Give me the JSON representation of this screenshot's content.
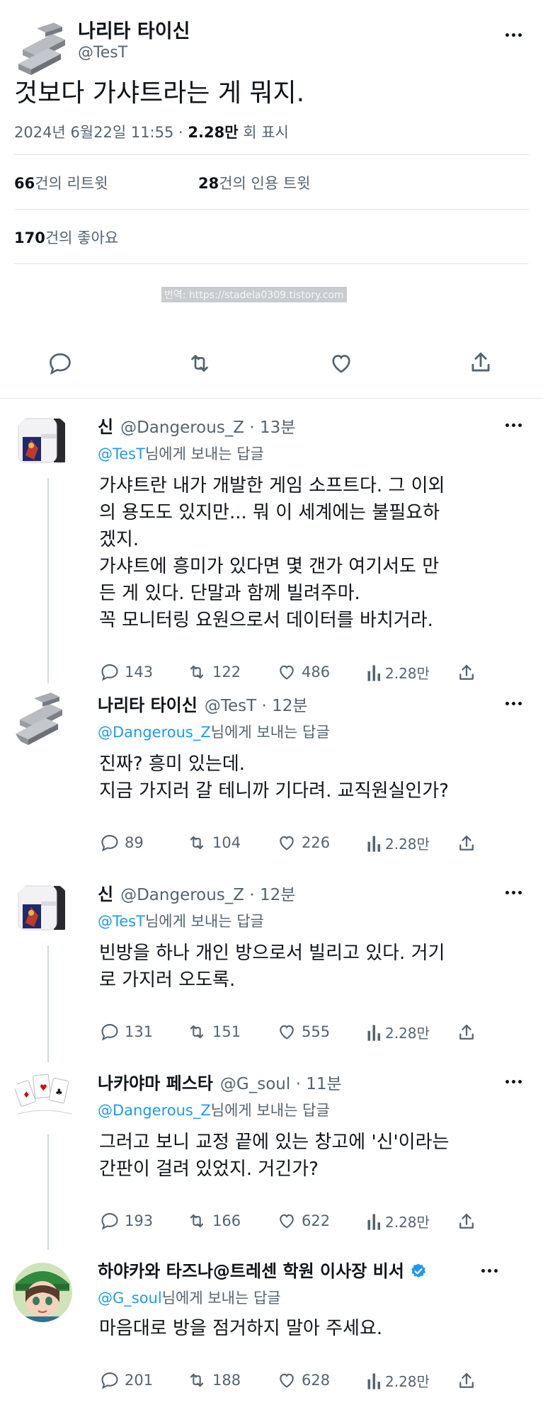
{
  "main_tweet": {
    "display_name": "나리타 타이신",
    "handle": "@TesT",
    "text": "것보다 가샤트라는 게 뭐지.",
    "timestamp": "2024년 6월22일 11:55 · ",
    "views_count": "2.28만",
    "views_label": " 회 표시",
    "retweets_count": "66",
    "retweets_label": "건의 리트윗",
    "quotes_count": "28",
    "quotes_label": "건의 인용 트윗",
    "likes_count": "170",
    "likes_label": "건의 좋아요",
    "watermark": "번역: https://stadela0309.tistory.com"
  },
  "replies": [
    {
      "display_name": "신",
      "handle": "@Dangerous_Z",
      "time": " · 13분",
      "reply_to_handle": "@TesT",
      "reply_to_suffix": "님에게 보내는 답글",
      "lines": [
        "가샤트란 내가 개발한 게임 소프트다. 그 이외",
        "의 용도도 있지만... 뭐 이 세계에는 불필요하",
        "겠지.",
        "가샤트에 흥미가 있다면 몇 갠가 여기서도 만",
        "든 게 있다. 단말과 함께 빌려주마.",
        "꼭 모니터링 요원으로서 데이터를 바치거라."
      ],
      "stats": {
        "replies": "143",
        "retweets": "122",
        "likes": "486",
        "views": "2.28만"
      }
    },
    {
      "display_name": "나리타 타이신",
      "handle": "@TesT",
      "time": " · 12분",
      "reply_to_handle": "@Dangerous_Z",
      "reply_to_suffix": "님에게 보내는 답글",
      "lines": [
        "진짜? 흥미 있는데.",
        "지금 가지러 갈 테니까 기다려. 교직원실인가?"
      ],
      "stats": {
        "replies": "89",
        "retweets": "104",
        "likes": "226",
        "views": "2.28만"
      }
    },
    {
      "display_name": "신",
      "handle": "@Dangerous_Z",
      "time": " · 12분",
      "reply_to_handle": "@TesT",
      "reply_to_suffix": "님에게 보내는 답글",
      "lines": [
        "빈방을 하나 개인 방으로서 빌리고 있다. 거기",
        "로 가지러 오도록."
      ],
      "stats": {
        "replies": "131",
        "retweets": "151",
        "likes": "555",
        "views": "2.28만"
      }
    },
    {
      "display_name": "나카야마 페스타",
      "handle": "@G_soul",
      "time": " · 11분",
      "reply_to_handle": "@Dangerous_Z",
      "reply_to_suffix": "님에게 보내는 답글",
      "lines": [
        "그러고 보니 교정 끝에 있는 창고에 '신'이라는",
        "간판이 걸려 있었지. 거긴가?"
      ],
      "stats": {
        "replies": "193",
        "retweets": "166",
        "likes": "622",
        "views": "2.28만"
      }
    },
    {
      "display_name": "하야카와 타즈나@트레센 학원 이사장 비서",
      "handle": "",
      "time": "",
      "reply_to_handle": "@G_soul",
      "reply_to_suffix": "님에게 보내는 답글",
      "lines": [
        "마음대로 방을 점거하지 말아 주세요."
      ],
      "stats": {
        "replies": "201",
        "retweets": "188",
        "likes": "628",
        "views": "2.28만"
      }
    }
  ],
  "colors": {
    "link": "#1d9bf0",
    "text": "#0f1419",
    "muted": "#536471",
    "divider": "#e1e6ea"
  }
}
